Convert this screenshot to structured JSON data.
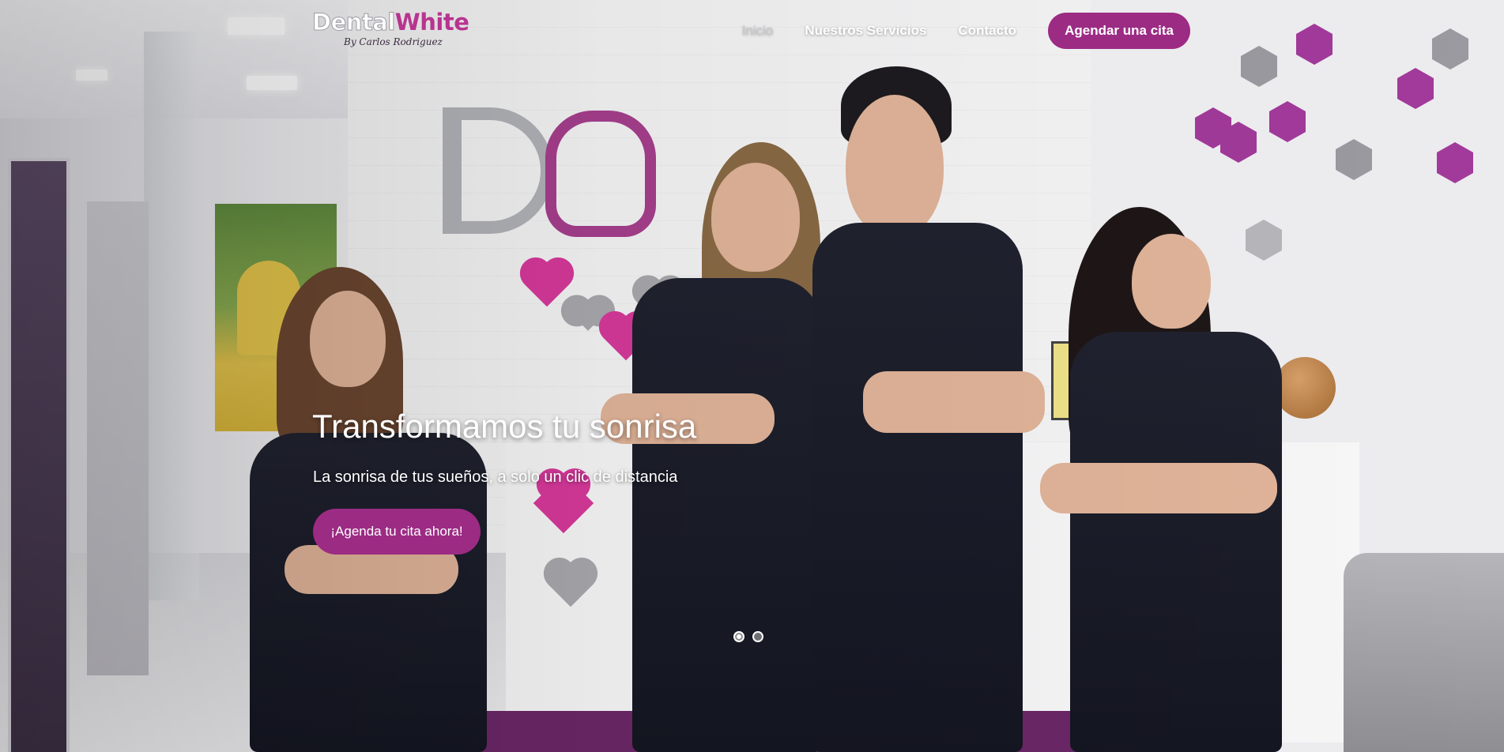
{
  "brand": {
    "logo_word_1": "Dental",
    "logo_word_2": "White",
    "logo_tagline": "By Carlos Rodriguez",
    "accent_color": "#9c2b84"
  },
  "nav": {
    "items": [
      {
        "label": "Inicio",
        "active": true
      },
      {
        "label": "Nuestros Servicios",
        "active": false
      },
      {
        "label": "Contacto",
        "active": false
      }
    ],
    "cta_label": "Agendar una cita"
  },
  "hero": {
    "title": "Transformamos tu sonrisa",
    "subtitle": "La sonrisa de tus sueños, a solo un clic de distancia",
    "cta_label": "¡Agenda tu cita ahora!",
    "slides_total": 2,
    "active_slide": 1
  },
  "icons": {
    "slide_dot": "dot-indicator-icon"
  }
}
